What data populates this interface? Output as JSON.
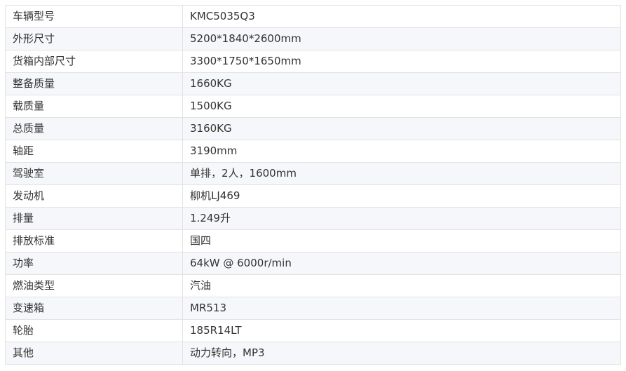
{
  "specs": [
    {
      "label": "车辆型号",
      "value": "KMC5035Q3"
    },
    {
      "label": "外形尺寸",
      "value": "5200*1840*2600mm"
    },
    {
      "label": "货箱内部尺寸",
      "value": "3300*1750*1650mm"
    },
    {
      "label": "整备质量",
      "value": "1660KG"
    },
    {
      "label": "载质量",
      "value": "1500KG"
    },
    {
      "label": "总质量",
      "value": "3160KG"
    },
    {
      "label": "轴距",
      "value": "3190mm"
    },
    {
      "label": "驾驶室",
      "value": "单排，2人，1600mm"
    },
    {
      "label": "发动机",
      "value": "柳机LJ469"
    },
    {
      "label": "排量",
      "value": "1.249升"
    },
    {
      "label": "排放标准",
      "value": "国四"
    },
    {
      "label": "功率",
      "value": "64kW @ 6000r/min"
    },
    {
      "label": "燃油类型",
      "value": "汽油"
    },
    {
      "label": "变速箱",
      "value": "MR513"
    },
    {
      "label": "轮胎",
      "value": "185R14LT"
    },
    {
      "label": "其他",
      "value": "动力转向，MP3"
    }
  ]
}
